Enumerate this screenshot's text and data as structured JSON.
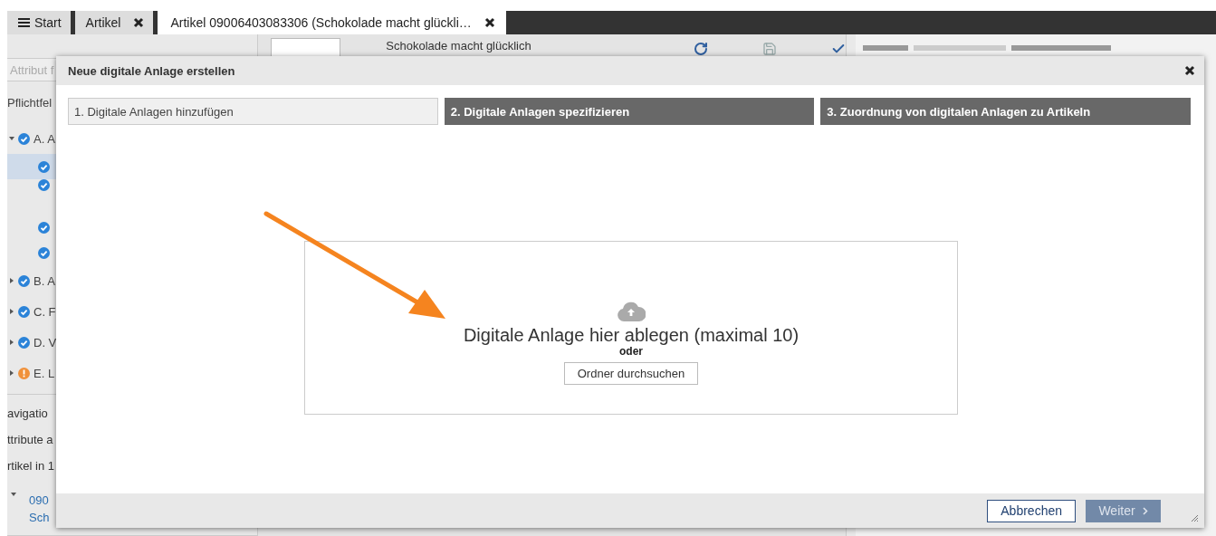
{
  "tabs": [
    {
      "label": "Start",
      "kind": "menu",
      "selected": false,
      "closable": false
    },
    {
      "label": "Artikel",
      "kind": "plain",
      "selected": false,
      "closable": true
    },
    {
      "label": "Artikel 09006403083306 (Schokolade macht glückli…",
      "kind": "plain",
      "selected": true,
      "closable": true
    }
  ],
  "article_header": {
    "title": "Schokolade macht glücklich"
  },
  "sidebar": {
    "search": {
      "placeholder": "Attribut f"
    },
    "filter_label": "Pflichtfel",
    "groups": [
      {
        "label": "A. A",
        "kind": "ok",
        "expanded": true,
        "children": [
          {
            "kind": "ok",
            "selected": true
          },
          {
            "kind": "ok",
            "selected": false
          },
          {
            "kind": "ok",
            "selected": false
          },
          {
            "kind": "ok",
            "selected": false
          }
        ]
      },
      {
        "label": "B. A",
        "kind": "ok",
        "expanded": false
      },
      {
        "label": "C. F",
        "kind": "ok",
        "expanded": false
      },
      {
        "label": "D. V",
        "kind": "ok",
        "expanded": false
      },
      {
        "label": "E. L",
        "kind": "warning",
        "expanded": false
      }
    ],
    "links": [
      "avigatio",
      "ttribute a",
      "rtikel in 1"
    ],
    "tree_item": {
      "expanded": true,
      "lines": [
        "090",
        "Sch"
      ]
    }
  },
  "dialog": {
    "title": "Neue digitale Anlage erstellen",
    "steps": [
      {
        "label": "1. Digitale Anlagen hinzufügen",
        "selected": true
      },
      {
        "label": "2. Digitale Anlagen spezifizieren",
        "selected": false
      },
      {
        "label": "3. Zuordnung von digitalen Anlagen zu Artikeln",
        "selected": false
      }
    ],
    "dropzone": {
      "text": "Digitale Anlage hier ablegen (maximal 10)",
      "separator": "oder",
      "browse": "Ordner durchsuchen"
    },
    "buttons": [
      {
        "label": "Abbrechen",
        "kind": "secondary",
        "disabled": false
      },
      {
        "label": "Weiter",
        "kind": "primary",
        "disabled": true
      }
    ]
  }
}
